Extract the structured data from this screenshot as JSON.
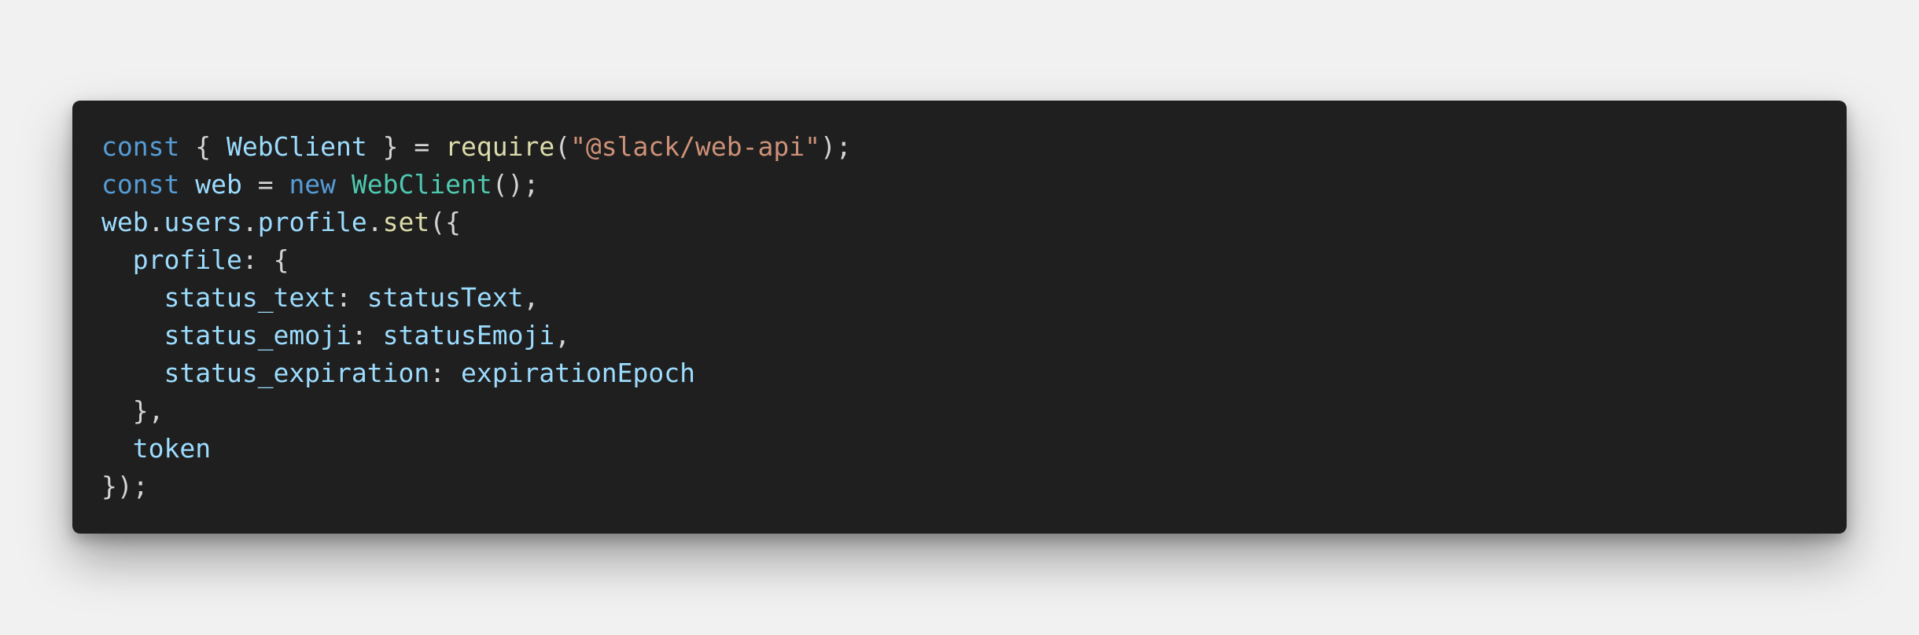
{
  "code": {
    "lines": [
      [
        {
          "text": "const",
          "kind": "keyword"
        },
        {
          "text": " { ",
          "kind": "punct"
        },
        {
          "text": "WebClient",
          "kind": "var"
        },
        {
          "text": " } = ",
          "kind": "punct"
        },
        {
          "text": "require",
          "kind": "func"
        },
        {
          "text": "(",
          "kind": "punct"
        },
        {
          "text": "\"@slack/web-api\"",
          "kind": "string"
        },
        {
          "text": ");",
          "kind": "punct"
        }
      ],
      [
        {
          "text": "const",
          "kind": "keyword"
        },
        {
          "text": " ",
          "kind": "punct"
        },
        {
          "text": "web",
          "kind": "var"
        },
        {
          "text": " = ",
          "kind": "punct"
        },
        {
          "text": "new",
          "kind": "keyword"
        },
        {
          "text": " ",
          "kind": "punct"
        },
        {
          "text": "WebClient",
          "kind": "class"
        },
        {
          "text": "();",
          "kind": "punct"
        }
      ],
      [
        {
          "text": "web",
          "kind": "var"
        },
        {
          "text": ".",
          "kind": "punct"
        },
        {
          "text": "users",
          "kind": "var"
        },
        {
          "text": ".",
          "kind": "punct"
        },
        {
          "text": "profile",
          "kind": "var"
        },
        {
          "text": ".",
          "kind": "punct"
        },
        {
          "text": "set",
          "kind": "func"
        },
        {
          "text": "({",
          "kind": "punct"
        }
      ],
      [
        {
          "text": "  ",
          "kind": "indent"
        },
        {
          "text": "profile",
          "kind": "var"
        },
        {
          "text": ": {",
          "kind": "punct"
        }
      ],
      [
        {
          "text": "    ",
          "kind": "indent"
        },
        {
          "text": "status_text",
          "kind": "var"
        },
        {
          "text": ": ",
          "kind": "punct"
        },
        {
          "text": "statusText",
          "kind": "var"
        },
        {
          "text": ",",
          "kind": "punct"
        }
      ],
      [
        {
          "text": "    ",
          "kind": "indent"
        },
        {
          "text": "status_emoji",
          "kind": "var"
        },
        {
          "text": ": ",
          "kind": "punct"
        },
        {
          "text": "statusEmoji",
          "kind": "var"
        },
        {
          "text": ",",
          "kind": "punct"
        }
      ],
      [
        {
          "text": "    ",
          "kind": "indent"
        },
        {
          "text": "status_expiration",
          "kind": "var"
        },
        {
          "text": ": ",
          "kind": "punct"
        },
        {
          "text": "expirationEpoch",
          "kind": "var"
        }
      ],
      [
        {
          "text": "  ",
          "kind": "indent"
        },
        {
          "text": "},",
          "kind": "punct"
        }
      ],
      [
        {
          "text": "  ",
          "kind": "indent"
        },
        {
          "text": "token",
          "kind": "var"
        }
      ],
      [
        {
          "text": "});",
          "kind": "punct"
        }
      ]
    ]
  },
  "colors": {
    "background": "#f1f1f1",
    "code_background": "#1f1f1f",
    "keyword": "#569cd6",
    "variable": "#9cdcfe",
    "punctuation": "#d4d4d4",
    "function": "#dcdcaa",
    "class": "#4ec9b0",
    "string": "#ce9178"
  }
}
